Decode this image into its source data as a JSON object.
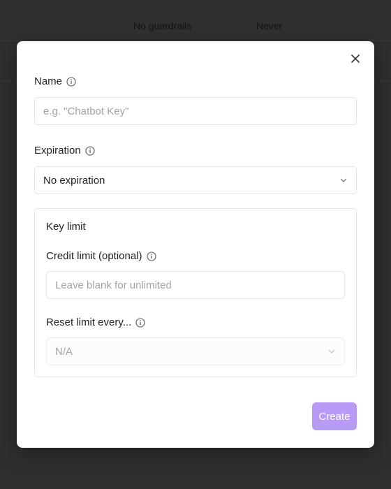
{
  "background": {
    "guardrails_text": "No guardrails",
    "expiration_text": "Never"
  },
  "modal": {
    "close_icon": "close-icon",
    "name": {
      "label": "Name",
      "placeholder": "e.g. \"Chatbot Key\"",
      "value": ""
    },
    "expiration": {
      "label": "Expiration",
      "selected": "No expiration"
    },
    "key_limit": {
      "title": "Key limit",
      "credit_limit": {
        "label": "Credit limit (optional)",
        "placeholder": "Leave blank for unlimited",
        "value": ""
      },
      "reset_limit": {
        "label": "Reset limit every...",
        "selected": "N/A"
      }
    },
    "create_label": "Create"
  },
  "colors": {
    "overlay": "#2f2f2f",
    "accent": "#b89af7"
  }
}
